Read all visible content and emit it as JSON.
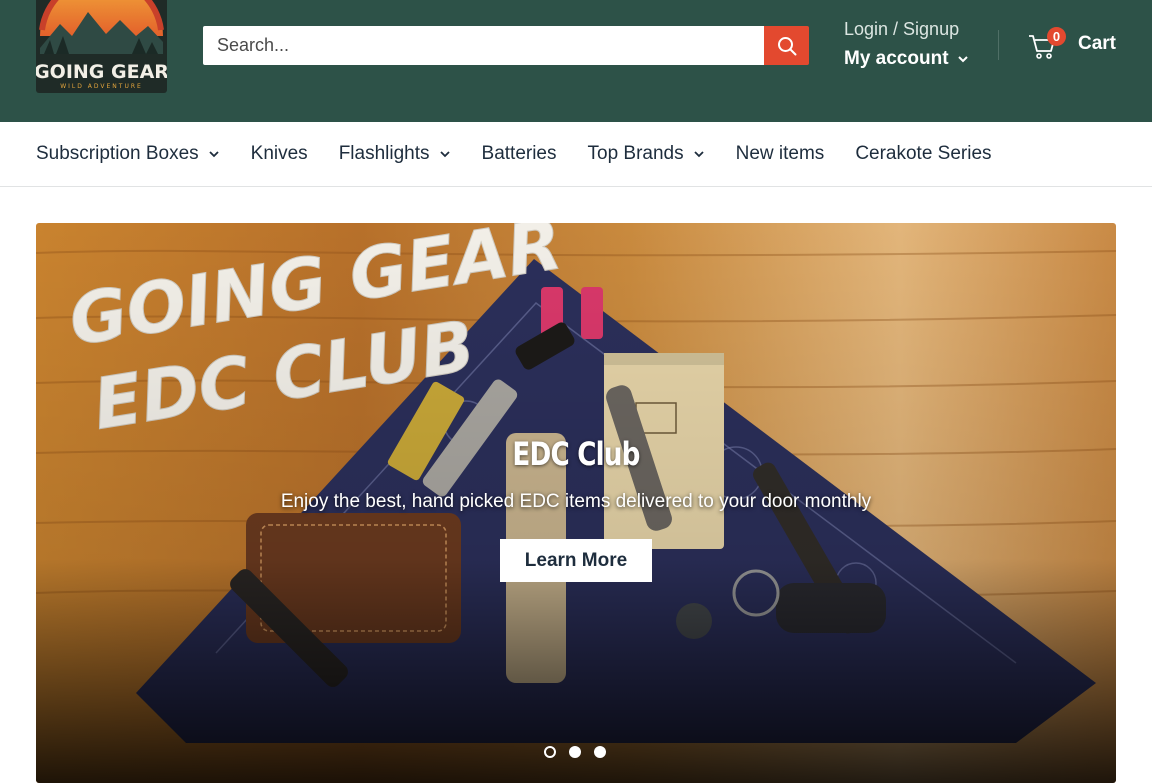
{
  "header": {
    "logo_name": "going-gear-logo",
    "search": {
      "placeholder": "Search...",
      "value": ""
    },
    "account": {
      "login_label": "Login / Signup",
      "my_account_label": "My account"
    },
    "cart": {
      "count": "0",
      "label": "Cart"
    }
  },
  "nav": {
    "items": [
      {
        "label": "Subscription Boxes",
        "has_dropdown": true
      },
      {
        "label": "Knives",
        "has_dropdown": false
      },
      {
        "label": "Flashlights",
        "has_dropdown": true
      },
      {
        "label": "Batteries",
        "has_dropdown": false
      },
      {
        "label": "Top Brands",
        "has_dropdown": true
      },
      {
        "label": "New items",
        "has_dropdown": false
      },
      {
        "label": "Cerakote Series",
        "has_dropdown": false
      }
    ]
  },
  "hero": {
    "title": "EDC Club",
    "subtitle": "Enjoy the best, hand picked EDC items delivered to your door monthly",
    "button_label": "Learn More",
    "slides": {
      "count": 3,
      "active": 1
    }
  },
  "colors": {
    "header_bg": "#2d5248",
    "accent": "#e3492f",
    "nav_text": "#1e2d3d"
  }
}
